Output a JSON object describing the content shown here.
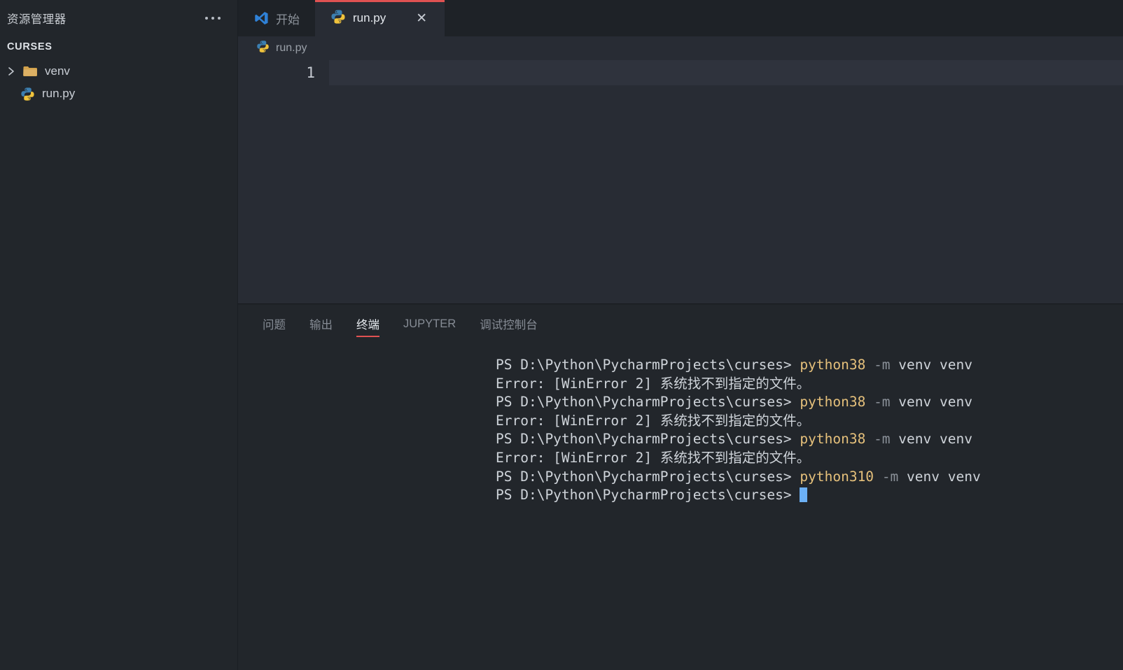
{
  "sidebar": {
    "title": "资源管理器",
    "more_actions_icon": "ellipsis-icon",
    "section_label": "CURSES",
    "tree": [
      {
        "name": "venv",
        "icon": "folder-icon",
        "expandable": true,
        "expanded": false
      },
      {
        "name": "run.py",
        "icon": "python-file-icon",
        "expandable": false
      }
    ]
  },
  "tabs": [
    {
      "label": "开始",
      "icon": "vscode-logo-icon",
      "active": false,
      "closable": false
    },
    {
      "label": "run.py",
      "icon": "python-file-icon",
      "active": true,
      "closable": true,
      "close_label": "✕"
    }
  ],
  "editor": {
    "breadcrumb": {
      "label": "run.py",
      "icon": "python-file-icon"
    },
    "line_number": "1",
    "line_content": ""
  },
  "panel": {
    "tabs": [
      {
        "label": "问题",
        "active": false
      },
      {
        "label": "输出",
        "active": false
      },
      {
        "label": "终端",
        "active": true
      },
      {
        "label": "JUPYTER",
        "active": false
      },
      {
        "label": "调试控制台",
        "active": false
      }
    ],
    "terminal_lines": [
      {
        "segments": [
          {
            "text": "PS D:\\Python\\PycharmProjects\\curses> ",
            "style": "plain"
          },
          {
            "text": "python38",
            "style": "yellow"
          },
          {
            "text": " ",
            "style": "plain"
          },
          {
            "text": "-m",
            "style": "dim"
          },
          {
            "text": " venv venv",
            "style": "plain"
          }
        ]
      },
      {
        "segments": [
          {
            "text": "Error: [WinError 2] 系统找不到指定的文件。",
            "style": "plain"
          }
        ]
      },
      {
        "segments": [
          {
            "text": "PS D:\\Python\\PycharmProjects\\curses> ",
            "style": "plain"
          },
          {
            "text": "python38",
            "style": "yellow"
          },
          {
            "text": " ",
            "style": "plain"
          },
          {
            "text": "-m",
            "style": "dim"
          },
          {
            "text": " venv venv",
            "style": "plain"
          }
        ]
      },
      {
        "segments": [
          {
            "text": "Error: [WinError 2] 系统找不到指定的文件。",
            "style": "plain"
          }
        ]
      },
      {
        "segments": [
          {
            "text": "PS D:\\Python\\PycharmProjects\\curses> ",
            "style": "plain"
          },
          {
            "text": "python38",
            "style": "yellow"
          },
          {
            "text": " ",
            "style": "plain"
          },
          {
            "text": "-m",
            "style": "dim"
          },
          {
            "text": " venv venv",
            "style": "plain"
          }
        ]
      },
      {
        "segments": [
          {
            "text": "Error: [WinError 2] 系统找不到指定的文件。",
            "style": "plain"
          }
        ]
      },
      {
        "segments": [
          {
            "text": "PS D:\\Python\\PycharmProjects\\curses> ",
            "style": "plain"
          },
          {
            "text": "python310",
            "style": "yellow"
          },
          {
            "text": " ",
            "style": "plain"
          },
          {
            "text": "-m",
            "style": "dim"
          },
          {
            "text": " venv venv",
            "style": "plain"
          }
        ]
      },
      {
        "segments": [
          {
            "text": "PS D:\\Python\\PycharmProjects\\curses> ",
            "style": "plain"
          },
          {
            "text": "",
            "style": "cursor"
          }
        ]
      }
    ]
  },
  "colors": {
    "accent_red": "#e05252",
    "terminal_yellow": "#e5c07b",
    "cursor_blue": "#6cb0f5",
    "editor_bg": "#282c34",
    "sidebar_bg": "#22262b",
    "tabbar_bg": "#1e2227",
    "current_line_bg": "#2f333d"
  }
}
